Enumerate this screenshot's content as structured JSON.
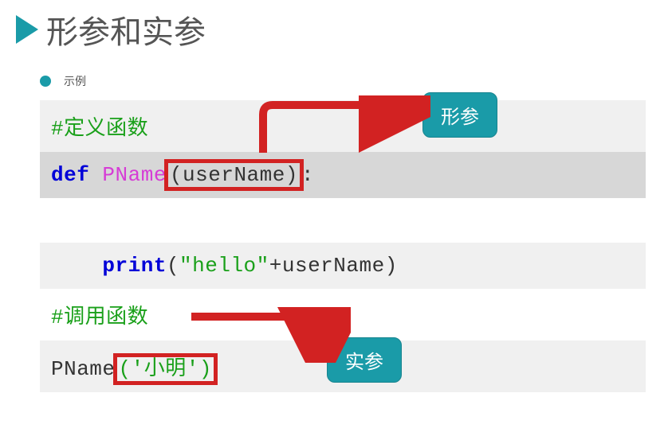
{
  "title": "形参和实参",
  "example": "示例",
  "badges": {
    "formal": "形参",
    "actual": "实参"
  },
  "code": {
    "comment_def": "#定义函数",
    "def_kw": "def",
    "func_name": "PName",
    "param_paren": "(userName)",
    "colon": ":",
    "print_kw": "print",
    "print_args_open": "(",
    "print_str": "\"hello\"",
    "print_plus_var": "+userName)",
    "comment_call": "#调用函数",
    "call_name": "PName",
    "call_args": "('小明')"
  }
}
